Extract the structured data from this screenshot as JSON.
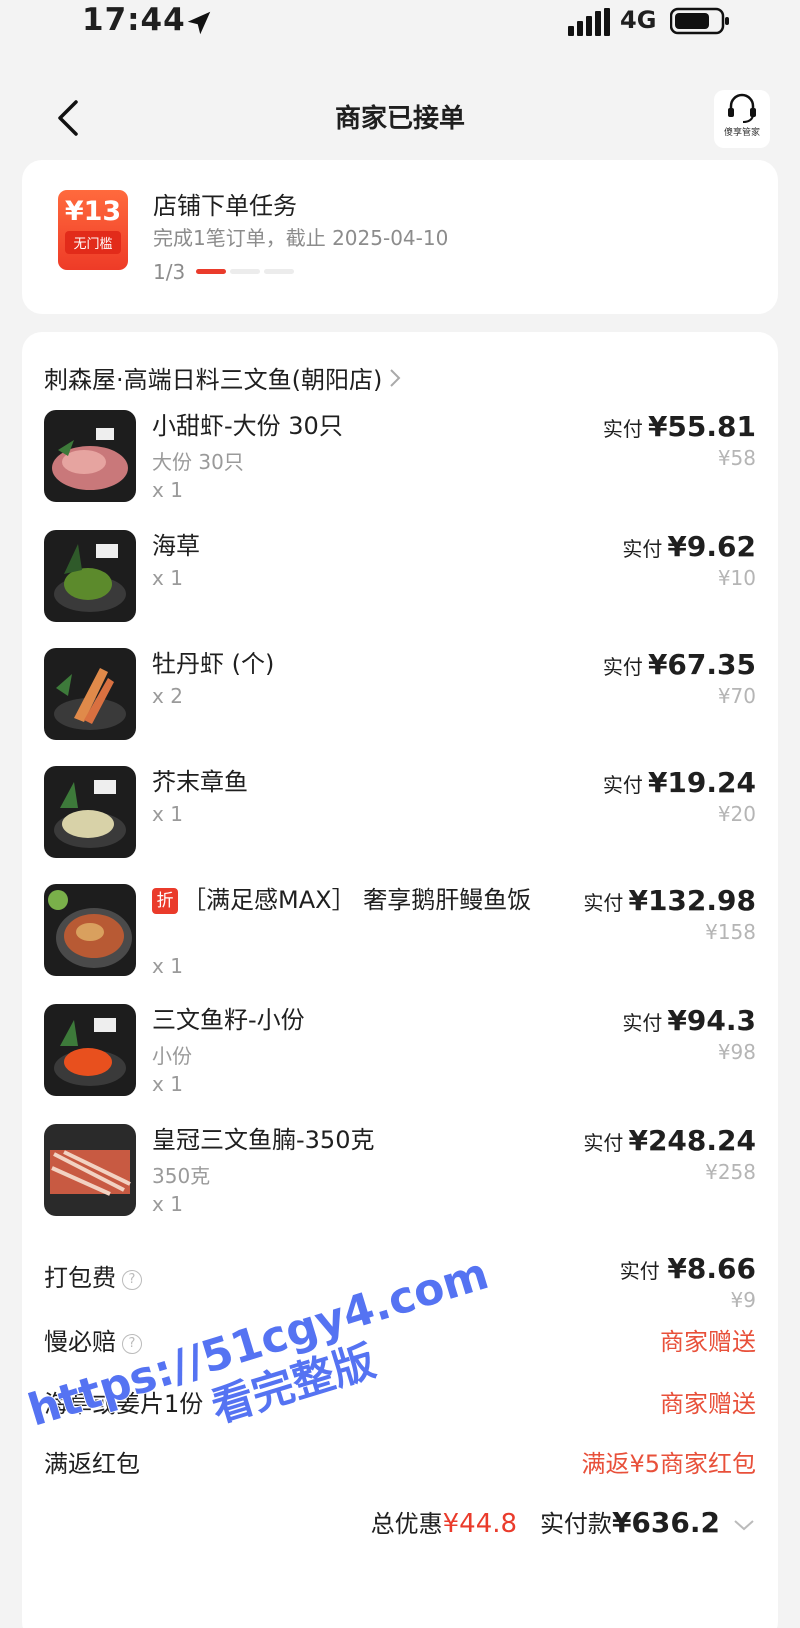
{
  "status_bar": {
    "time": "17:44",
    "network": "4G"
  },
  "nav": {
    "title": "商家已接单",
    "service_label": "傻享管家"
  },
  "task": {
    "coupon_value": "¥13",
    "coupon_condition": "无门槛",
    "title": "店铺下单任务",
    "description": "完成1笔订单，截止 2025-04-10",
    "progress_text": "1/3",
    "progress_done": 1,
    "progress_total": 3
  },
  "order": {
    "store_name": "刺森屋·高端日料三文鱼(朝阳店)",
    "paid_label": "实付",
    "items": [
      {
        "name": "小甜虾-大份 30只",
        "spec": "大份 30只",
        "qty": "x 1",
        "paid": "¥55.81",
        "original": "¥58"
      },
      {
        "name": "海草",
        "spec": "",
        "qty": "x 1",
        "paid": "¥9.62",
        "original": "¥10"
      },
      {
        "name": "牡丹虾 (个)",
        "spec": "",
        "qty": "x 2",
        "paid": "¥67.35",
        "original": "¥70"
      },
      {
        "name": "芥末章鱼",
        "spec": "",
        "qty": "x 1",
        "paid": "¥19.24",
        "original": "¥20"
      },
      {
        "tag": "折",
        "name": "［满足感MAX］ 奢享鹅肝鳗鱼饭",
        "spec": "",
        "qty": "x 1",
        "paid": "¥132.98",
        "original": "¥158"
      },
      {
        "name": "三文鱼籽-小份",
        "spec": "小份",
        "qty": "x 1",
        "paid": "¥94.3",
        "original": "¥98"
      },
      {
        "name": "皇冠三文鱼腩-350克",
        "spec": "350克",
        "qty": "x 1",
        "paid": "¥248.24",
        "original": "¥258"
      }
    ],
    "packing_fee": {
      "label": "打包费",
      "paid": "¥8.66",
      "original": "¥9"
    },
    "slow_compensation": {
      "label": "慢必赔",
      "value": "商家赠送"
    },
    "gift": {
      "label": "海草或姜片1份",
      "value": "商家赠送"
    },
    "red_packet": {
      "label": "满返红包",
      "value": "满返¥5商家红包"
    },
    "total": {
      "discount_label": "总优惠",
      "discount_value": "¥44.8",
      "paid_label": "实付款",
      "paid_value": "¥636.2"
    }
  },
  "watermark": {
    "line1": "https://51cgy4.com",
    "line2": "看完整版"
  },
  "colors": {
    "accent_red": "#ea3b2b",
    "gift_red": "#e8503a",
    "watermark_blue": "#4a6cf0"
  }
}
